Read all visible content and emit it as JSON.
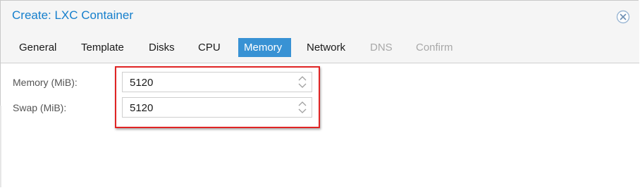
{
  "dialog": {
    "title": "Create: LXC Container",
    "close_icon": "close-circle-icon"
  },
  "tabs": [
    {
      "label": "General",
      "state": "normal"
    },
    {
      "label": "Template",
      "state": "normal"
    },
    {
      "label": "Disks",
      "state": "normal"
    },
    {
      "label": "CPU",
      "state": "normal"
    },
    {
      "label": "Memory",
      "state": "active"
    },
    {
      "label": "Network",
      "state": "normal"
    },
    {
      "label": "DNS",
      "state": "disabled"
    },
    {
      "label": "Confirm",
      "state": "disabled"
    }
  ],
  "form": {
    "memory": {
      "label": "Memory (MiB):",
      "value": "5120"
    },
    "swap": {
      "label": "Swap (MiB):",
      "value": "5120"
    }
  },
  "colors": {
    "accent": "#157fcc",
    "active_tab": "#3892d4",
    "highlight": "#e02424"
  }
}
